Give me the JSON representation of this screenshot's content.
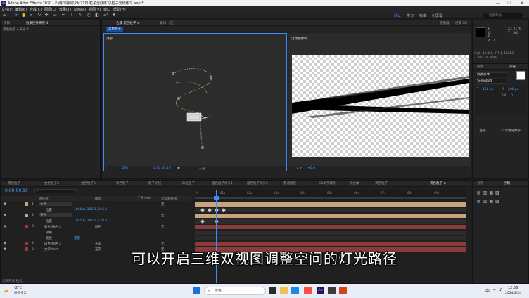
{
  "window": {
    "title": "Adobe After Effects 2020 - F:\\练习存储\\2月21日 粒子光线练习\\粒子光线练习.aep *",
    "logo": "Ae",
    "controls": [
      "—",
      "☐",
      "✕"
    ]
  },
  "menu": [
    "文件(F)",
    "编辑(E)",
    "合成(C)",
    "图层(L)",
    "效果(T)",
    "动画(A)",
    "视图(V)",
    "窗口",
    "帮助(H)"
  ],
  "toolbar": {
    "workspaces": [
      "默认",
      "学习",
      "标准",
      "小屏幕"
    ],
    "active_workspace": "默认",
    "search_placeholder": "搜索帮助"
  },
  "project_panel": {
    "tabs": [
      "项目",
      "效果控件天光 4"
    ],
    "active_tab": "效果控件天光 4",
    "subtitle": "黑色粒子 • 天光 4"
  },
  "comp_panel": {
    "tabs": [
      "合成 黑色粒子 ≡",
      "素材 （无）"
    ],
    "active_tab": "合成 黑色粒子 ≡",
    "header_right": [
      "渲染器",
      "经典 3D"
    ],
    "breadcrumb": "黑色粒子",
    "left_view_label": "顶部",
    "right_view_label": "活动摄像机",
    "footer_left": [
      "33%",
      "0:00:00:19",
      "（三分…",
      "2 个…"
    ],
    "footer_right": "+0.0"
  },
  "info_panel": {
    "lines": [
      "R :",
      "G :",
      "B :",
      "A : 0",
      "X : 2176",
      "Y : 502"
    ],
    "extra": [
      "外部：1940.8, 379.6, 1224.2",
      "→ -642.03, 4869"
    ]
  },
  "char_panel": {
    "tabs": [
      "段落",
      "字符"
    ],
    "font": "思源黑体",
    "style": "SemiBold",
    "size": "151 px",
    "leading": "200 px",
    "tracking": "0",
    "options": [
      "连字",
      "印地语数字"
    ]
  },
  "timeline": {
    "tabs": [
      "黑色粒子",
      "金色粒子2",
      "金色粒子3",
      "青色粒子",
      "粒子光线",
      "彩虹粒子",
      "蓝色粒子线条1",
      "蓝色粒子线条2",
      "普通图层",
      "3D文字线条",
      "综合类",
      "黄色粒子",
      "黄色粒子 ≡"
    ],
    "active_tab": "黄色粒子 ≡",
    "timecode": "0:00:00:19",
    "columns": [
      "源名称",
      "模式",
      "T TrkMat",
      "父级和链接"
    ],
    "ruler": [
      "0f",
      "01s",
      "02s",
      "03s",
      "04s",
      "05s",
      "06s",
      "07s",
      "08s",
      "09s"
    ],
    "layers": [
      {
        "num": "1",
        "name": "天光",
        "mode": "",
        "parent": "无"
      },
      {
        "num": "",
        "name": "位置",
        "value": "1868.8, 102.1, 166.3",
        "mode": "",
        "parent": ""
      },
      {
        "num": "2",
        "name": "天光",
        "mode": "",
        "parent": "无"
      },
      {
        "num": "",
        "name": "位置",
        "value": "1955.6, 187.1, 178.4",
        "mode": "",
        "parent": ""
      },
      {
        "num": "3",
        "name": "白色 纯色 3",
        "mode": "颜色",
        "parent": "无"
      },
      {
        "num": "",
        "name": "效果",
        "value": "",
        "mode": "",
        "parent": ""
      },
      {
        "num": "",
        "name": "变换",
        "value": "",
        "mode": "重置",
        "parent": ""
      },
      {
        "num": "4",
        "name": "白色 纯色 3",
        "mode": "正常",
        "parent": "无"
      },
      {
        "num": "5",
        "name": "文字 text",
        "mode": "正常",
        "parent": "无"
      }
    ],
    "footer": "切换开关/模式"
  },
  "right_bottom_panel": {
    "tabs": [
      "对齐",
      "控制"
    ],
    "active_tab": "控制"
  },
  "subtitle": "可以开启三维双视图调整空间的灯光路径",
  "taskbar": {
    "weather_temp": "-2°C",
    "weather_text": "局部多云",
    "search": "搜索",
    "lang": "中",
    "time": "12:56",
    "date": "2024/2/24"
  },
  "colors": {
    "accent": "#3d8bff",
    "track_tan": "#c9a27e",
    "track_red": "#8a3b3b",
    "ae_purple": "#9999ff"
  }
}
